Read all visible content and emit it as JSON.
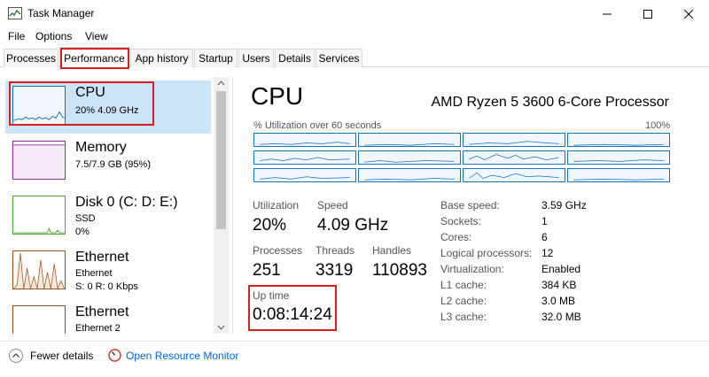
{
  "window": {
    "title": "Task Manager"
  },
  "menu": [
    "File",
    "Options",
    "View"
  ],
  "tabs": [
    "Processes",
    "Performance",
    "App history",
    "Startup",
    "Users",
    "Details",
    "Services"
  ],
  "sidebar": {
    "items": [
      {
        "title": "CPU",
        "lines": [
          "20%  4.09 GHz"
        ]
      },
      {
        "title": "Memory",
        "lines": [
          "7.5/7.9 GB (95%)"
        ]
      },
      {
        "title": "Disk 0 (C: D: E:)",
        "lines": [
          "SSD",
          "0%"
        ]
      },
      {
        "title": "Ethernet",
        "lines": [
          "Ethernet",
          "S: 0 R: 0 Kbps"
        ]
      },
      {
        "title": "Ethernet",
        "lines": [
          "Ethernet 2"
        ]
      }
    ]
  },
  "detail": {
    "title": "CPU",
    "processor": "AMD Ryzen 5 3600 6-Core Processor",
    "graph_label": "% Utilization over 60 seconds",
    "graph_max": "100%",
    "stats": {
      "utilization_label": "Utilization",
      "utilization": "20%",
      "speed_label": "Speed",
      "speed": "4.09 GHz",
      "processes_label": "Processes",
      "processes": "251",
      "threads_label": "Threads",
      "threads": "3319",
      "handles_label": "Handles",
      "handles": "110893",
      "uptime_label": "Up time",
      "uptime": "0:08:14:24"
    },
    "specs": [
      {
        "label": "Base speed:",
        "value": "3.59 GHz"
      },
      {
        "label": "Sockets:",
        "value": "1"
      },
      {
        "label": "Cores:",
        "value": "6"
      },
      {
        "label": "Logical processors:",
        "value": "12"
      },
      {
        "label": "Virtualization:",
        "value": "Enabled"
      },
      {
        "label": "L1 cache:",
        "value": "384 KB"
      },
      {
        "label": "L2 cache:",
        "value": "3.0 MB"
      },
      {
        "label": "L3 cache:",
        "value": "32.0 MB"
      }
    ]
  },
  "footer": {
    "fewer": "Fewer details",
    "resource_monitor": "Open Resource Monitor"
  },
  "colors": {
    "cpu": "#1173b9",
    "memory": "#8b2bab",
    "disk": "#4aa52a",
    "ethernet": "#a7521a",
    "highlight": "#d62020"
  }
}
